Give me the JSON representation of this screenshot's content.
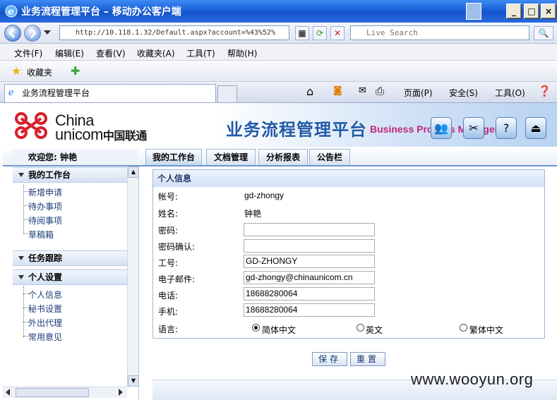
{
  "window": {
    "title": "业务流程管理平台 – 移动办公客户端",
    "buttons": {
      "minimize": "_",
      "maximize": "□",
      "close": "×"
    }
  },
  "addressbar": {
    "url": "http://10.118.1.32/Default.aspx?account=%43%52%",
    "search_placeholder": "Live Search"
  },
  "menu": [
    "文件(F)",
    "编辑(E)",
    "查看(V)",
    "收藏夹(A)",
    "工具(T)",
    "帮助(H)"
  ],
  "favorites": {
    "label": "收藏夹"
  },
  "tabs": {
    "active_label": "业务流程管理平台"
  },
  "commandbar": {
    "page": "页面(P)",
    "safety": "安全(S)",
    "tools": "工具(O)"
  },
  "banner": {
    "logo_china": "China",
    "logo_unicom": "unicom",
    "logo_cn": "中国联通",
    "title": "业务流程管理平台",
    "subtitle": "Business Process Manager"
  },
  "nav": {
    "welcome": "欢迎您: 钟艳",
    "tabs": [
      "我的工作台",
      "文档管理",
      "分析报表",
      "公告栏"
    ]
  },
  "sidebar": {
    "sections": [
      {
        "title": "我的工作台",
        "items": [
          "新增申请",
          "待办事项",
          "待阅事项",
          "草稿箱"
        ]
      },
      {
        "title": "任务跟踪",
        "items": []
      },
      {
        "title": "个人设置",
        "items": [
          "个人信息",
          "秘书设置",
          "外出代理",
          "常用意见"
        ]
      }
    ]
  },
  "form": {
    "heading": "个人信息",
    "account_label": "帐号:",
    "account_value": "gd-zhongy",
    "name_label": "姓名:",
    "name_value": "钟艳",
    "password_label": "密码:",
    "password_value": "",
    "password_confirm_label": "密码确认:",
    "password_confirm_value": "",
    "empno_label": "工号:",
    "empno_value": "GD-ZHONGY",
    "email_label": "电子邮件:",
    "email_value": "gd-zhongy@chinaunicom.cn",
    "phone_label": "电话:",
    "phone_value": "18688280064",
    "mobile_label": "手机:",
    "mobile_value": "18688280064",
    "language_label": "语言:",
    "languages": [
      "简体中文",
      "英文",
      "繁体中文"
    ],
    "selected_language": "简体中文",
    "save_label": "保存",
    "reset_label": "重置"
  },
  "watermark": "www.wooyun.org"
}
